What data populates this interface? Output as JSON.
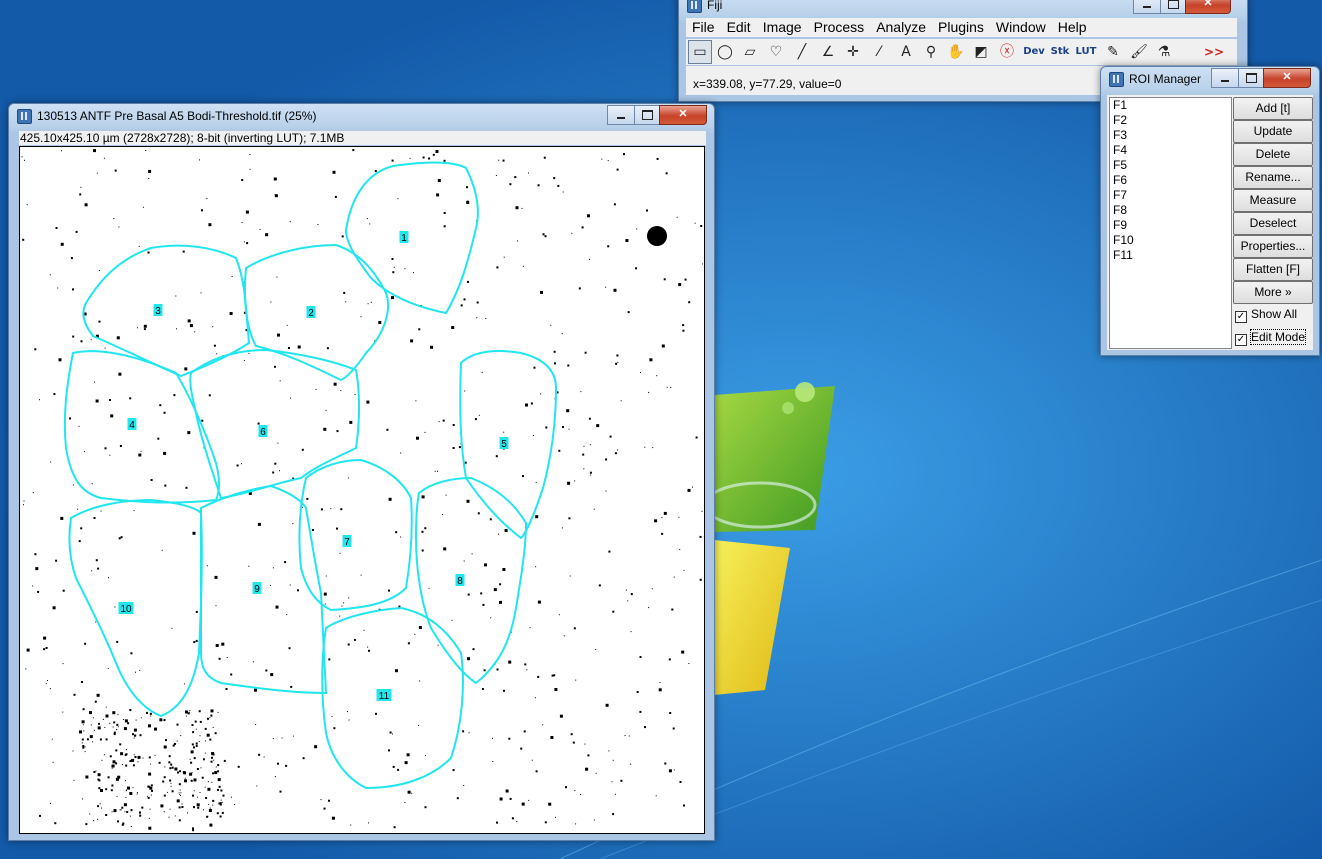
{
  "desktop": {
    "background": "#1f6fc2"
  },
  "fiji": {
    "title": "Fiji",
    "menu": [
      "File",
      "Edit",
      "Image",
      "Process",
      "Analyze",
      "Plugins",
      "Window",
      "Help"
    ],
    "tools": [
      {
        "name": "rectangle-tool-icon",
        "glyph": "▭"
      },
      {
        "name": "oval-tool-icon",
        "glyph": "◯"
      },
      {
        "name": "polygon-tool-icon",
        "glyph": "▱"
      },
      {
        "name": "freehand-tool-icon",
        "glyph": "♡"
      },
      {
        "name": "line-tool-icon",
        "glyph": "╱"
      },
      {
        "name": "angle-tool-icon",
        "glyph": "∠"
      },
      {
        "name": "point-tool-icon",
        "glyph": "✛"
      },
      {
        "name": "wand-tool-icon",
        "glyph": "⁄"
      },
      {
        "name": "text-tool-icon",
        "glyph": "A"
      },
      {
        "name": "magnifier-tool-icon",
        "glyph": "⚲"
      },
      {
        "name": "hand-tool-icon",
        "glyph": "✋"
      },
      {
        "name": "color-picker-tool-icon",
        "glyph": "◩"
      },
      {
        "name": "stop-icon",
        "glyph": "ⓧ"
      },
      {
        "name": "dev-menu-icon",
        "glyph": "Dev"
      },
      {
        "name": "stack-menu-icon",
        "glyph": "Stk"
      },
      {
        "name": "lut-menu-icon",
        "glyph": "LUT"
      },
      {
        "name": "pencil-tool-icon",
        "glyph": "✎"
      },
      {
        "name": "brush-tool-icon",
        "glyph": "🖌"
      },
      {
        "name": "flood-fill-tool-icon",
        "glyph": "⚗"
      },
      {
        "name": "more-tools-icon",
        "glyph": ">>"
      }
    ],
    "status": "x=339.08, y=77.29, value=0"
  },
  "roi_manager": {
    "title": "ROI Manager",
    "entries": [
      "F1",
      "F2",
      "F3",
      "F4",
      "F5",
      "F6",
      "F7",
      "F8",
      "F9",
      "F10",
      "F11"
    ],
    "buttons": [
      "Add [t]",
      "Update",
      "Delete",
      "Rename...",
      "Measure",
      "Deselect",
      "Properties...",
      "Flatten [F]",
      "More »"
    ],
    "show_all_label": "Show All",
    "show_all_checked": true,
    "edit_mode_label": "Edit Mode",
    "edit_mode_checked": true
  },
  "image_window": {
    "title": "130513 ANTF Pre Basal A5 Bodi-Threshold.tif (25%)",
    "info": "425.10x425.10 µm (2728x2728); 8-bit (inverting LUT); 7.1MB",
    "roi_color": "#22e6ee",
    "roi_labels": [
      "1",
      "2",
      "3",
      "4",
      "5",
      "6",
      "7",
      "8",
      "9",
      "10",
      "11"
    ]
  }
}
